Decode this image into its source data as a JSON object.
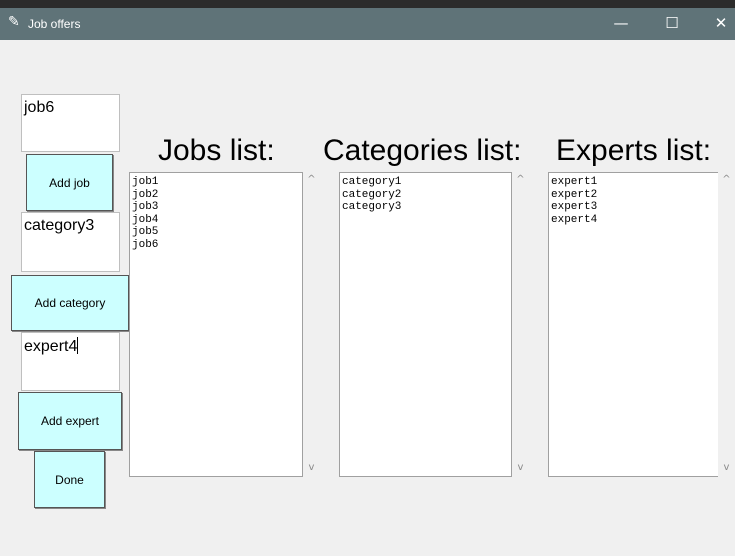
{
  "window": {
    "title": "Job offers",
    "minimize": "—",
    "maximize": "☐",
    "close": "✕"
  },
  "inputs": {
    "job": "job6",
    "category": "category3",
    "expert": "expert4"
  },
  "buttons": {
    "add_job": "Add job",
    "add_category": "Add category",
    "add_expert": "Add expert",
    "done": "Done"
  },
  "headings": {
    "jobs": "Jobs list:",
    "categories": "Categories list:",
    "experts": "Experts list:"
  },
  "lists": {
    "jobs": [
      "job1",
      "job2",
      "job3",
      "job4",
      "job5",
      "job6"
    ],
    "categories": [
      "category1",
      "category2",
      "category3"
    ],
    "experts": [
      "expert1",
      "expert2",
      "expert3",
      "expert4"
    ]
  },
  "scroll_arrows": {
    "up": "^",
    "down": "v"
  }
}
